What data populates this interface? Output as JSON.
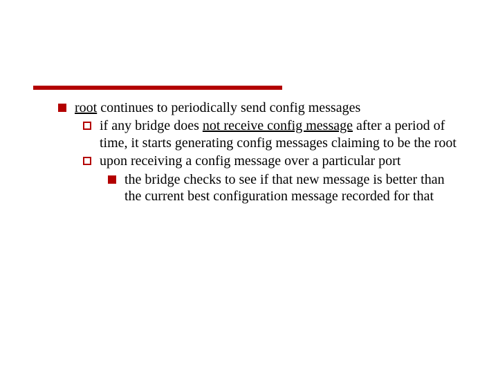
{
  "bullets": {
    "lvl1": {
      "pre": "root",
      "post": " continues to periodically send config messages"
    },
    "lvl2a": {
      "pre": "if any bridge does ",
      "underlined": "not receive config message",
      "post": " after a period of time, it starts generating config messages claiming to be the root"
    },
    "lvl2b": {
      "text": "upon receiving a config message over a particular port"
    },
    "lvl3": {
      "text": "the bridge checks to see if that new message is better than the current best configuration message recorded for that"
    }
  }
}
